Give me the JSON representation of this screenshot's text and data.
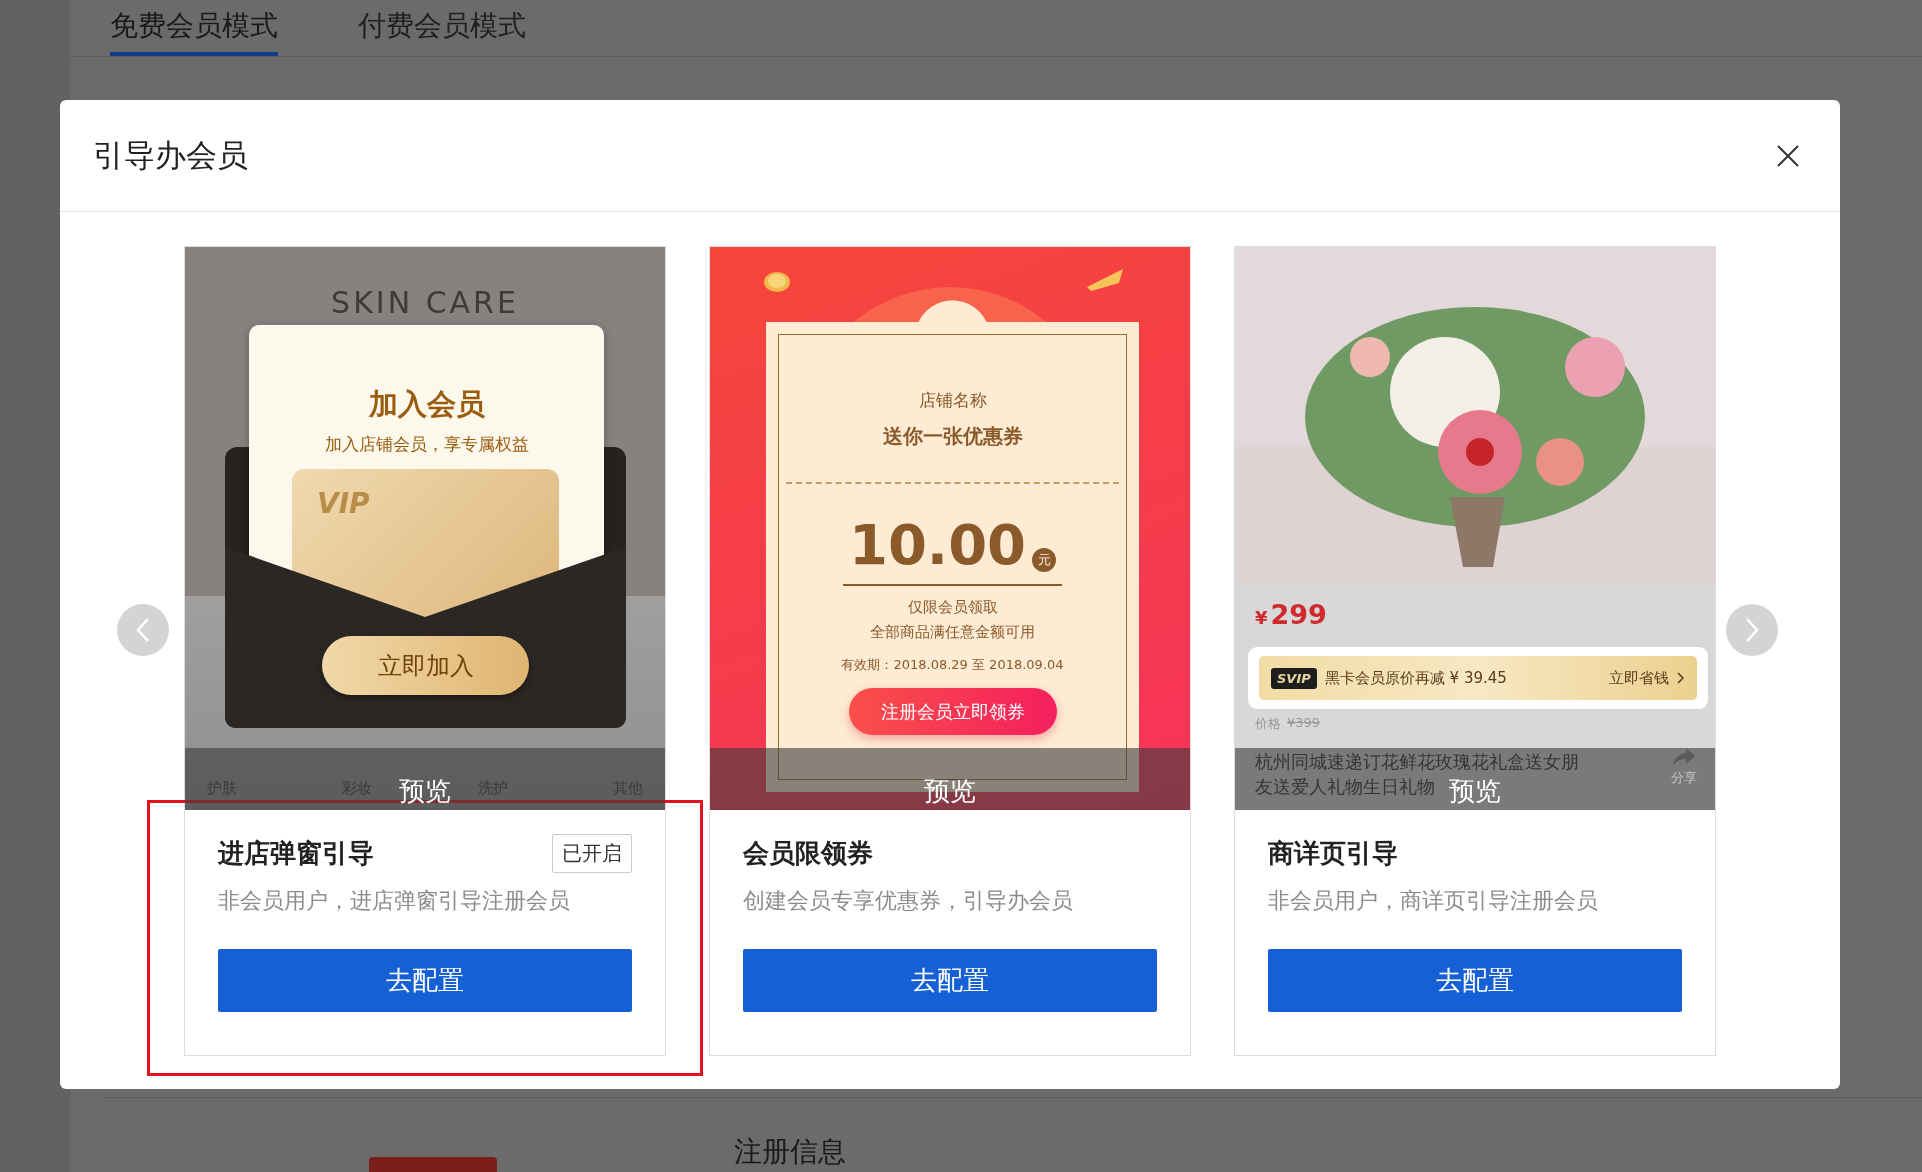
{
  "background": {
    "tabs": [
      {
        "label": "免费会员模式",
        "selected": true
      },
      {
        "label": "付费会员模式",
        "selected": false
      }
    ],
    "section_title": "注册信息"
  },
  "dialog": {
    "title": "引导办会员",
    "cards": [
      {
        "kind": "popup",
        "highlighted": true,
        "title": "进店弹窗引导",
        "status_badge": "已开启",
        "description": "非会员用户，进店弹窗引导注册会员",
        "button": "去配置",
        "preview": {
          "backdrop_text": "SKIN CARE",
          "heading": "加入会员",
          "subheading": "加入店铺会员，享专属权益",
          "card_text": "VIP",
          "join_button": "立即加入",
          "categories": [
            "护肤",
            "彩妆",
            "洗护",
            "其他"
          ],
          "overlay_label": "预览"
        }
      },
      {
        "kind": "coupon",
        "highlighted": false,
        "title": "会员限领券",
        "description": "创建会员专享优惠券，引导办会员",
        "button": "去配置",
        "preview": {
          "shop_name": "店铺名称",
          "headline": "送你一张优惠券",
          "amount": "10.00",
          "unit": "元",
          "condition_1": "仅限会员领取",
          "condition_2": "全部商品满任意金额可用",
          "validity": "有效期：2018.08.29 至 2018.09.04",
          "claim_button": "注册会员立即领券",
          "overlay_label": "预览"
        }
      },
      {
        "kind": "product",
        "highlighted": false,
        "title": "商详页引导",
        "description": "非会员用户，商详页引导注册会员",
        "button": "去配置",
        "preview": {
          "price_symbol": "¥",
          "price": "299",
          "svip_badge": "SVIP",
          "svip_offer": "黑卡会员原价再减 ¥ 39.45",
          "svip_action": "立即省钱",
          "original_price_label": "价格",
          "original_price": "¥399",
          "product_title_lines": [
            "杭州同城速递订花鲜花玫瑰花礼盒送女朋",
            "友送爱人礼物生日礼物"
          ],
          "share_label": "分享",
          "overlay_label": "预览"
        }
      }
    ]
  }
}
